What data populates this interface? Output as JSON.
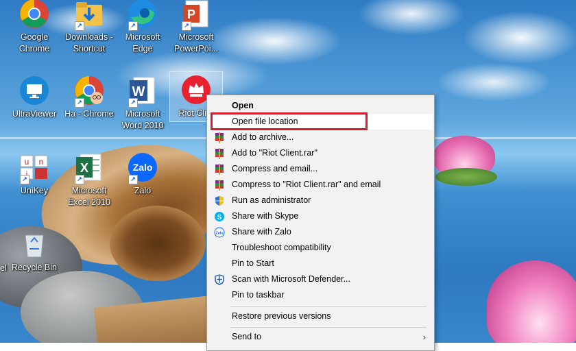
{
  "desktop": {
    "icons": [
      {
        "label": "Google Chrome",
        "name": "chrome-icon"
      },
      {
        "label": "Downloads - Shortcut",
        "name": "downloads-folder-icon"
      },
      {
        "label": "Microsoft Edge",
        "name": "edge-icon"
      },
      {
        "label": "Microsoft PowerPoi...",
        "name": "powerpoint-icon"
      },
      {
        "label": "UltraViewer",
        "name": "ultraviewer-icon"
      },
      {
        "label": "Ha - Chrome",
        "name": "chrome-profile-icon"
      },
      {
        "label": "Microsoft Word 2010",
        "name": "word-icon"
      },
      {
        "label": "Riot Cli...",
        "name": "riot-client-icon"
      },
      {
        "label": "UniKey",
        "name": "unikey-icon"
      },
      {
        "label": "Microsoft Excel 2010",
        "name": "excel-icon"
      },
      {
        "label": "Zalo",
        "name": "zalo-icon"
      },
      {
        "label": "Recycle Bin",
        "name": "recycle-bin-icon"
      },
      {
        "label": "el",
        "name": "partial-icon"
      }
    ]
  },
  "context_menu": {
    "items": [
      {
        "label": "Open",
        "icon": ""
      },
      {
        "label": "Open file location",
        "icon": ""
      },
      {
        "label": "Add to archive...",
        "icon": "winrar-icon"
      },
      {
        "label": "Add to \"Riot Client.rar\"",
        "icon": "winrar-icon"
      },
      {
        "label": "Compress and email...",
        "icon": "winrar-icon"
      },
      {
        "label": "Compress to \"Riot Client.rar\" and email",
        "icon": "winrar-icon"
      },
      {
        "label": "Run as administrator",
        "icon": "uac-shield-icon"
      },
      {
        "label": "Share with Skype",
        "icon": "skype-icon"
      },
      {
        "label": "Share with Zalo",
        "icon": "zalo-icon"
      },
      {
        "label": "Troubleshoot compatibility",
        "icon": ""
      },
      {
        "label": "Pin to Start",
        "icon": ""
      },
      {
        "label": "Scan with Microsoft Defender...",
        "icon": "defender-icon"
      },
      {
        "label": "Pin to taskbar",
        "icon": ""
      },
      {
        "label": "Restore previous versions",
        "icon": ""
      },
      {
        "label": "Send to",
        "icon": ""
      }
    ],
    "send_to_arrow": "›"
  },
  "colors": {
    "highlight_box": "#d21e2b",
    "menu_bg": "#f2f2f2"
  }
}
